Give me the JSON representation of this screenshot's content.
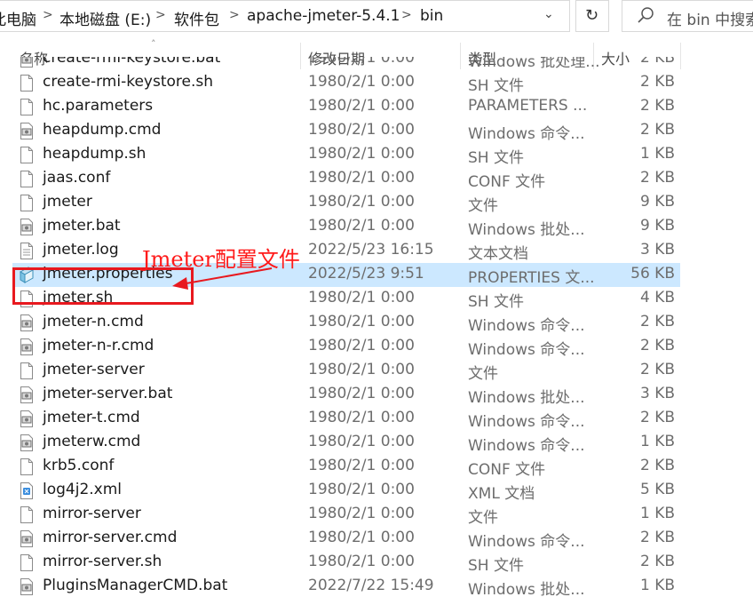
{
  "address_bar": {
    "crumbs": [
      "此电脑",
      "本地磁盘 (E:)",
      "软件包",
      "apache-jmeter-5.4.1",
      "bin"
    ],
    "separator": ">"
  },
  "search": {
    "placeholder": "在 bin 中搜索"
  },
  "columns": {
    "name": "名称",
    "modified": "修改日期",
    "type": "类型",
    "size": "大小"
  },
  "files": [
    {
      "name": "create-rmi-keystore.bat",
      "date": "1980/2/1 0:00",
      "type": "Windows 批处理...",
      "size": "2 KB",
      "icon": "bat-file-icon"
    },
    {
      "name": "create-rmi-keystore.sh",
      "date": "1980/2/1 0:00",
      "type": "SH 文件",
      "size": "2 KB",
      "icon": "generic-file-icon"
    },
    {
      "name": "hc.parameters",
      "date": "1980/2/1 0:00",
      "type": "PARAMETERS ...",
      "size": "2 KB",
      "icon": "generic-file-icon"
    },
    {
      "name": "heapdump.cmd",
      "date": "1980/2/1 0:00",
      "type": "Windows 命令...",
      "size": "2 KB",
      "icon": "cmd-file-icon"
    },
    {
      "name": "heapdump.sh",
      "date": "1980/2/1 0:00",
      "type": "SH 文件",
      "size": "1 KB",
      "icon": "generic-file-icon"
    },
    {
      "name": "jaas.conf",
      "date": "1980/2/1 0:00",
      "type": "CONF 文件",
      "size": "2 KB",
      "icon": "generic-file-icon"
    },
    {
      "name": "jmeter",
      "date": "1980/2/1 0:00",
      "type": "文件",
      "size": "9 KB",
      "icon": "generic-file-icon"
    },
    {
      "name": "jmeter.bat",
      "date": "1980/2/1 0:00",
      "type": "Windows 批处...",
      "size": "9 KB",
      "icon": "bat-file-icon"
    },
    {
      "name": "jmeter.log",
      "date": "2022/5/23 16:15",
      "type": "文本文档",
      "size": "3 KB",
      "icon": "text-file-icon"
    },
    {
      "name": "jmeter.properties",
      "date": "2022/5/23 9:51",
      "type": "PROPERTIES 文...",
      "size": "56 KB",
      "icon": "properties-file-icon"
    },
    {
      "name": "jmeter.sh",
      "date": "1980/2/1 0:00",
      "type": "SH 文件",
      "size": "4 KB",
      "icon": "generic-file-icon"
    },
    {
      "name": "jmeter-n.cmd",
      "date": "1980/2/1 0:00",
      "type": "Windows 命令...",
      "size": "2 KB",
      "icon": "cmd-file-icon"
    },
    {
      "name": "jmeter-n-r.cmd",
      "date": "1980/2/1 0:00",
      "type": "Windows 命令...",
      "size": "2 KB",
      "icon": "cmd-file-icon"
    },
    {
      "name": "jmeter-server",
      "date": "1980/2/1 0:00",
      "type": "文件",
      "size": "2 KB",
      "icon": "generic-file-icon"
    },
    {
      "name": "jmeter-server.bat",
      "date": "1980/2/1 0:00",
      "type": "Windows 批处...",
      "size": "3 KB",
      "icon": "bat-file-icon"
    },
    {
      "name": "jmeter-t.cmd",
      "date": "1980/2/1 0:00",
      "type": "Windows 命令...",
      "size": "2 KB",
      "icon": "cmd-file-icon"
    },
    {
      "name": "jmeterw.cmd",
      "date": "1980/2/1 0:00",
      "type": "Windows 命令...",
      "size": "1 KB",
      "icon": "cmd-file-icon"
    },
    {
      "name": "krb5.conf",
      "date": "1980/2/1 0:00",
      "type": "CONF 文件",
      "size": "2 KB",
      "icon": "generic-file-icon"
    },
    {
      "name": "log4j2.xml",
      "date": "1980/2/1 0:00",
      "type": "XML 文档",
      "size": "5 KB",
      "icon": "xml-file-icon"
    },
    {
      "name": "mirror-server",
      "date": "1980/2/1 0:00",
      "type": "文件",
      "size": "1 KB",
      "icon": "generic-file-icon"
    },
    {
      "name": "mirror-server.cmd",
      "date": "1980/2/1 0:00",
      "type": "Windows 命令...",
      "size": "2 KB",
      "icon": "cmd-file-icon"
    },
    {
      "name": "mirror-server.sh",
      "date": "1980/2/1 0:00",
      "type": "SH 文件",
      "size": "2 KB",
      "icon": "generic-file-icon"
    },
    {
      "name": "PluginsManagerCMD.bat",
      "date": "2022/7/22 15:49",
      "type": "Windows 批处...",
      "size": "1 KB",
      "icon": "bat-file-icon"
    }
  ],
  "selected_index": 9,
  "annotation": {
    "text": "Jmeter配置文件",
    "color": "#e8191f"
  },
  "colors": {
    "selection": "#cce8ff",
    "annotation": "#e8191f"
  }
}
